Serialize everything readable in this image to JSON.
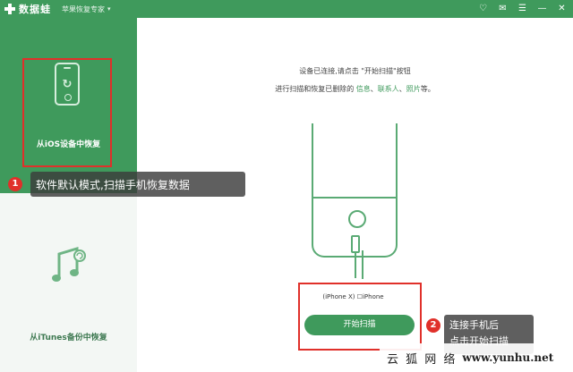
{
  "titlebar": {
    "app_name": "数据蛙",
    "subtitle": "苹果恢复专家",
    "subtitle_caret": "▾",
    "controls": [
      "♡",
      "✉",
      "☰",
      "—",
      "✕"
    ]
  },
  "sidebar": {
    "items": [
      {
        "label": "从iOS设备中恢复",
        "icon": "phone-sync-icon",
        "active": true
      },
      {
        "label": "从iTunes备份中恢复",
        "icon": "music-note-icon",
        "active": false
      }
    ]
  },
  "main": {
    "instruction_line1": "设备已连接,请点击 \"开始扫描\"按钮",
    "instruction_line2_prefix": "进行扫描和恢复已删除的 ",
    "instruction_links": [
      "信息",
      "联系人",
      "照片"
    ],
    "instruction_line2_sep1": "、",
    "instruction_line2_sep2": "、",
    "instruction_line2_suffix": "等。",
    "device_name": "(iPhone X) ☐iPhone",
    "start_button": "开始扫描"
  },
  "callouts": {
    "one": {
      "number": "1",
      "text": "软件默认模式,扫描手机恢复数据"
    },
    "two": {
      "number": "2",
      "line1": "连接手机后",
      "line2": "点击开始扫描"
    }
  },
  "watermark": {
    "text": "云 狐 网 络",
    "url": "www.yunhu.net"
  },
  "colors": {
    "brand_green": "#3f9a5c",
    "highlight_red": "#e0302a",
    "sidebar_bg": "#f3f7f4"
  }
}
